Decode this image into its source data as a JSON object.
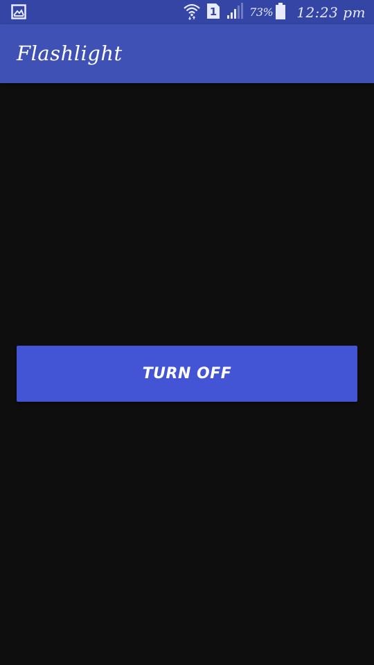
{
  "status_bar": {
    "notification_icon": "image-icon",
    "wifi_icon": "wifi-icon",
    "sim_icon": "sim-1-icon",
    "sim_label": "1",
    "signal_icon": "signal-icon",
    "battery_percent": "73%",
    "battery_icon": "battery-icon",
    "time": "12:23 pm"
  },
  "app_bar": {
    "title": "Flashlight"
  },
  "main": {
    "toggle_button_label": "TURN OFF"
  },
  "colors": {
    "status_bar": "#3445a6",
    "app_bar": "#3f51b5",
    "background": "#0e0e0e",
    "button": "#4355d4"
  }
}
